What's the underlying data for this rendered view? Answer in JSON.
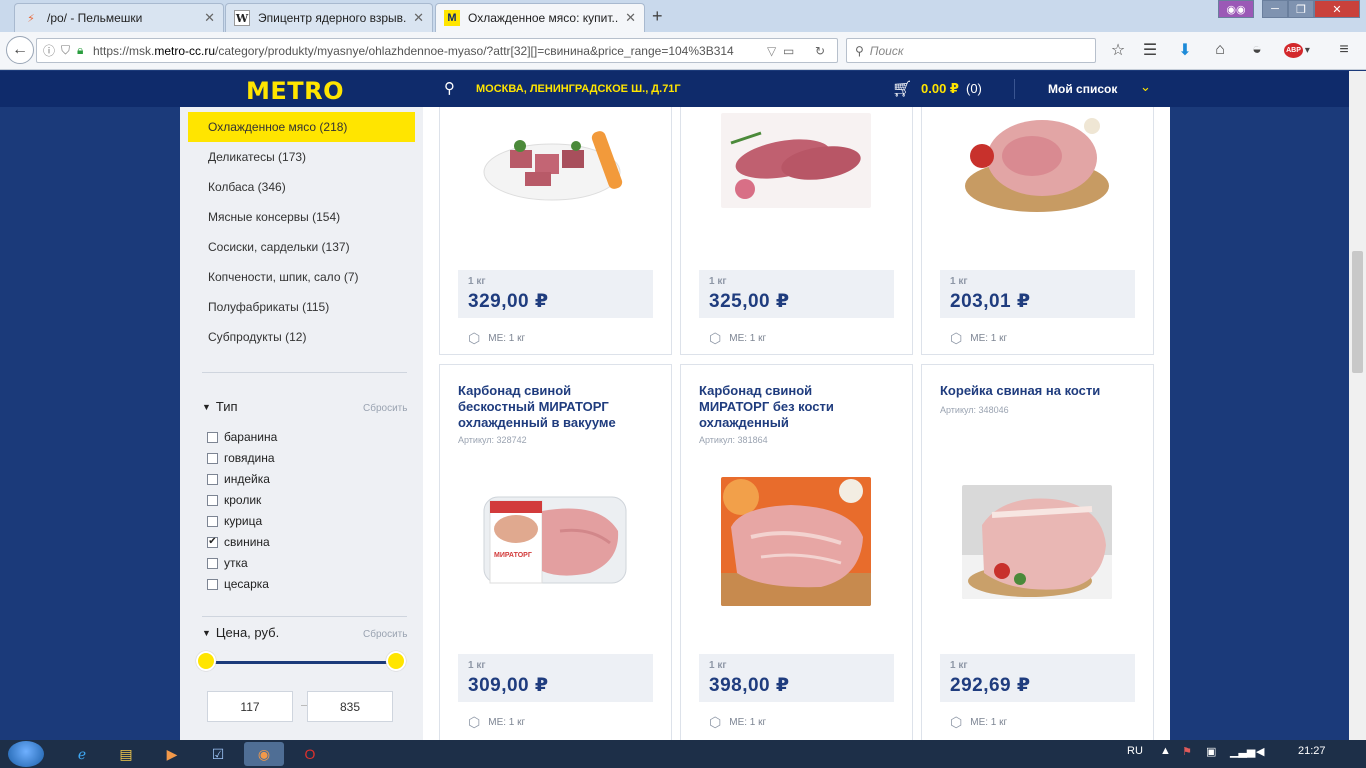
{
  "browser": {
    "tabs": [
      {
        "title": "/po/ - Пельмешки",
        "icon": "thunder-icon"
      },
      {
        "title": "Эпицентр ядерного взрыв...",
        "icon": "wikipedia-icon"
      },
      {
        "title": "Охлажденное мясо: купит...",
        "icon": "metro-icon"
      }
    ],
    "url_prefix": "https://msk.",
    "url_domain": "metro-cc.ru",
    "url_rest": "/category/produkty/myasnye/ohlazhdennoe-myaso/?attr[32][]=свинина&price_range=104%3B314",
    "search_placeholder": "Поиск",
    "adblock_label": "ABP"
  },
  "site": {
    "logo": "METRO",
    "address": "МОСКВА, ЛЕНИНГРАДСКОЕ Ш., Д.71Г",
    "cart_amount": "0.00 ₽",
    "cart_count": "(0)",
    "my_list": "Мой список"
  },
  "sidebar": {
    "categories": [
      {
        "label": "Охлажденное мясо (218)"
      },
      {
        "label": "Деликатесы (173)"
      },
      {
        "label": "Колбаса (346)"
      },
      {
        "label": "Мясные консервы (154)"
      },
      {
        "label": "Сосиски, сардельки (137)"
      },
      {
        "label": "Копчености, шпик, сало (7)"
      },
      {
        "label": "Полуфабрикаты (115)"
      },
      {
        "label": "Субпродукты (12)"
      }
    ],
    "type_filter": {
      "title": "Тип",
      "reset": "Сбросить",
      "options": [
        {
          "label": "баранина",
          "checked": false
        },
        {
          "label": "говядина",
          "checked": false
        },
        {
          "label": "индейка",
          "checked": false
        },
        {
          "label": "кролик",
          "checked": false
        },
        {
          "label": "курица",
          "checked": false
        },
        {
          "label": "свинина",
          "checked": true
        },
        {
          "label": "утка",
          "checked": false
        },
        {
          "label": "цесарка",
          "checked": false
        }
      ]
    },
    "price_filter": {
      "title": "Цена, руб.",
      "reset": "Сбросить",
      "min": "117",
      "max": "835"
    }
  },
  "products_top": [
    {
      "unit": "1 кг",
      "price": "329,00 ₽",
      "me": "МЕ: 1 кг"
    },
    {
      "unit": "1 кг",
      "price": "325,00 ₽",
      "me": "МЕ: 1 кг"
    },
    {
      "unit": "1 кг",
      "price": "203,01 ₽",
      "me": "МЕ: 1 кг"
    }
  ],
  "products_bottom": [
    {
      "name": "Карбонад свиной бескостный МИРАТОРГ охлажденный в вакууме",
      "sku": "Артикул: 328742",
      "unit": "1 кг",
      "price": "309,00 ₽",
      "me": "МЕ: 1 кг",
      "brand_label": "МИРАТОРГ"
    },
    {
      "name": "Карбонад свиной МИРАТОРГ без кости охлажденный",
      "sku": "Артикул: 381864",
      "unit": "1 кг",
      "price": "398,00 ₽",
      "me": "МЕ: 1 кг"
    },
    {
      "name": "Корейка свиная на кости",
      "sku": "Артикул: 348046",
      "unit": "1 кг",
      "price": "292,69 ₽",
      "me": "МЕ: 1 кг"
    }
  ],
  "taskbar": {
    "lang": "RU",
    "time": "21:27"
  },
  "colors": {
    "brand_yellow": "#ffe500",
    "brand_blue": "#0f2b6b",
    "price_blue": "#1f3c7e"
  }
}
